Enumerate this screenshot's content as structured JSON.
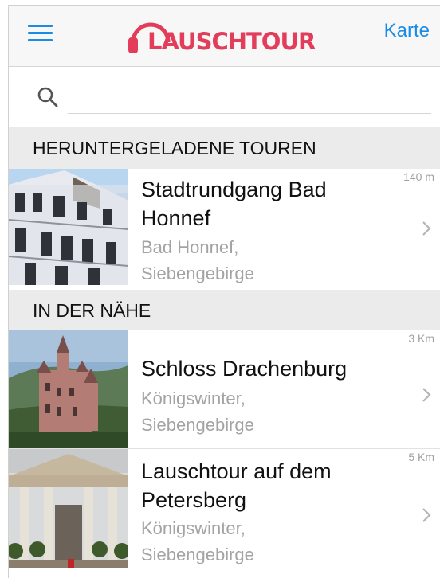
{
  "header": {
    "menu_icon": "hamburger-menu-icon",
    "logo_text": "LAUSCHTOUR",
    "logo_icon": "headphones-icon",
    "map_link": "Karte",
    "accent": "#1a8ce3",
    "brand": "#e23d5a"
  },
  "search": {
    "icon": "search-icon",
    "value": "",
    "placeholder": ""
  },
  "sections": [
    {
      "heading": "HERUNTERGELADENE TOUREN",
      "tours": [
        {
          "title_line1": "Stadtrundgang Bad",
          "title_line2": "Honnef",
          "location_line1": "Bad Honnef,",
          "location_line2": "Siebengebirge",
          "distance": "140 m",
          "image": "historic-townhouse-facade-photo"
        }
      ]
    },
    {
      "heading": "IN DER NÄHE",
      "tours": [
        {
          "title_line1": "Schloss Drachenburg",
          "title_line2": "",
          "location_line1": "Königswinter,",
          "location_line2": "Siebengebirge",
          "distance": "3 Km",
          "image": "castle-on-hill-photo"
        },
        {
          "title_line1": "Lauschtour auf dem",
          "title_line2": "Petersberg",
          "location_line1": "Königswinter,",
          "location_line2": "Siebengebirge",
          "distance": "5 Km",
          "image": "hotel-portico-entrance-photo"
        }
      ]
    }
  ]
}
